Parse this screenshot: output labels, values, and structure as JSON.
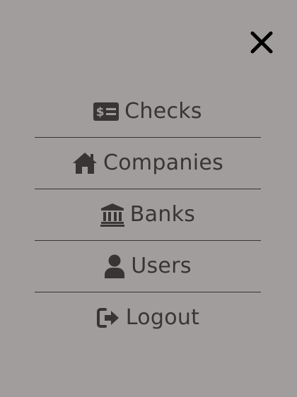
{
  "close": {
    "icon": "close-icon"
  },
  "menu": {
    "items": [
      {
        "label": "Checks",
        "icon": "money-check-icon"
      },
      {
        "label": "Companies",
        "icon": "home-icon"
      },
      {
        "label": "Banks",
        "icon": "bank-icon"
      },
      {
        "label": "Users",
        "icon": "user-icon"
      },
      {
        "label": "Logout",
        "icon": "logout-icon"
      }
    ]
  },
  "colors": {
    "background": "#a19d9d",
    "text": "#3a3535",
    "close_icon": "#000000",
    "divider": "#3a3434"
  }
}
